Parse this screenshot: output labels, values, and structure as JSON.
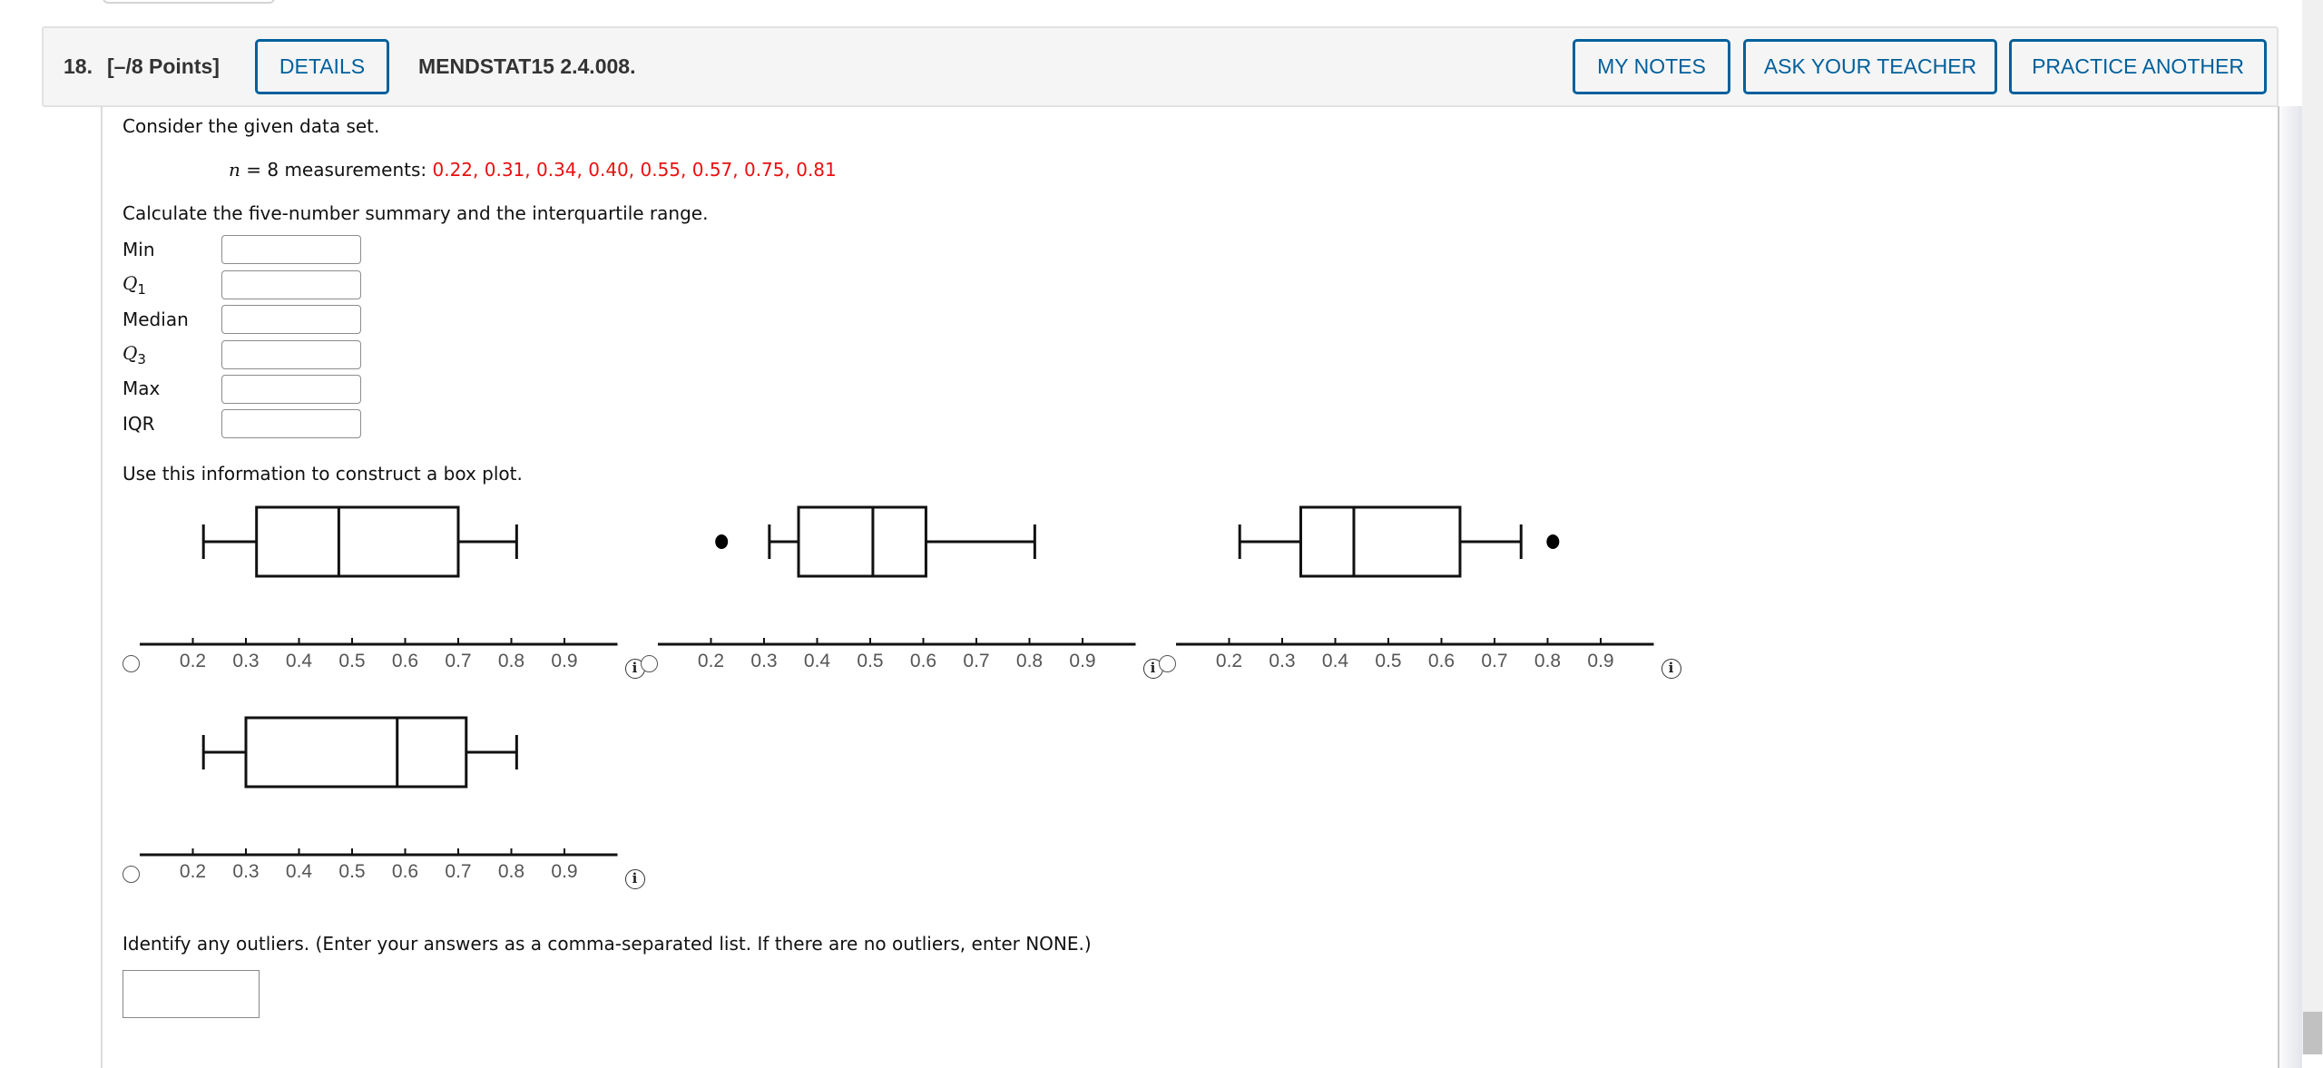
{
  "header": {
    "question_number": "18.",
    "points": "[–/8 Points]",
    "details_label": "DETAILS",
    "problem_code": "MENDSTAT15 2.4.008.",
    "my_notes_label": "MY NOTES",
    "ask_teacher_label": "ASK YOUR TEACHER",
    "practice_another_label": "PRACTICE ANOTHER",
    "accent_color": "#00609c"
  },
  "problem": {
    "intro": "Consider the given data set.",
    "n_var": "n",
    "n_text": " = 8 measurements: ",
    "measurements": "0.22, 0.31, 0.34, 0.40, 0.55, 0.57, 0.75, 0.81",
    "measurement_color": "#e8100f",
    "instruction": "Calculate the five-number summary and the interquartile range.",
    "fields": [
      {
        "label": "Min",
        "value": ""
      },
      {
        "label": "Q",
        "sub": "1",
        "value": ""
      },
      {
        "label": "Median",
        "value": ""
      },
      {
        "label": "Q",
        "sub": "3",
        "value": ""
      },
      {
        "label": "Max",
        "value": ""
      },
      {
        "label": "IQR",
        "value": ""
      }
    ],
    "boxplot_instruction": "Use this information to construct a box plot.",
    "outlier_prompt": "Identify any outliers. (Enter your answers as a comma-separated list. If there are no outliers, enter NONE.)",
    "outlier_value": ""
  },
  "chart_data": [
    {
      "type": "boxplot",
      "option": 1,
      "selected": false,
      "axis_range": [
        0.1,
        1.0
      ],
      "ticks": [
        "0.2",
        "0.3",
        "0.4",
        "0.5",
        "0.6",
        "0.7",
        "0.8",
        "0.9"
      ],
      "whisker_low": 0.22,
      "q1": 0.32,
      "median": 0.475,
      "q3": 0.7,
      "whisker_high": 0.81,
      "outliers": []
    },
    {
      "type": "boxplot",
      "option": 2,
      "selected": false,
      "axis_range": [
        0.1,
        1.0
      ],
      "ticks": [
        "0.2",
        "0.3",
        "0.4",
        "0.5",
        "0.6",
        "0.7",
        "0.8",
        "0.9"
      ],
      "whisker_low": 0.31,
      "q1": 0.365,
      "median": 0.505,
      "q3": 0.605,
      "whisker_high": 0.81,
      "outliers": [
        0.22
      ]
    },
    {
      "type": "boxplot",
      "option": 3,
      "selected": false,
      "axis_range": [
        0.1,
        1.0
      ],
      "ticks": [
        "0.2",
        "0.3",
        "0.4",
        "0.5",
        "0.6",
        "0.7",
        "0.8",
        "0.9"
      ],
      "whisker_low": 0.22,
      "q1": 0.335,
      "median": 0.435,
      "q3": 0.635,
      "whisker_high": 0.75,
      "outliers": [
        0.81
      ]
    },
    {
      "type": "boxplot",
      "option": 4,
      "selected": false,
      "axis_range": [
        0.1,
        1.0
      ],
      "ticks": [
        "0.2",
        "0.3",
        "0.4",
        "0.5",
        "0.6",
        "0.7",
        "0.8",
        "0.9"
      ],
      "whisker_low": 0.22,
      "q1": 0.3,
      "median": 0.585,
      "q3": 0.715,
      "whisker_high": 0.81,
      "outliers": []
    }
  ],
  "icons": {
    "info": "i"
  }
}
